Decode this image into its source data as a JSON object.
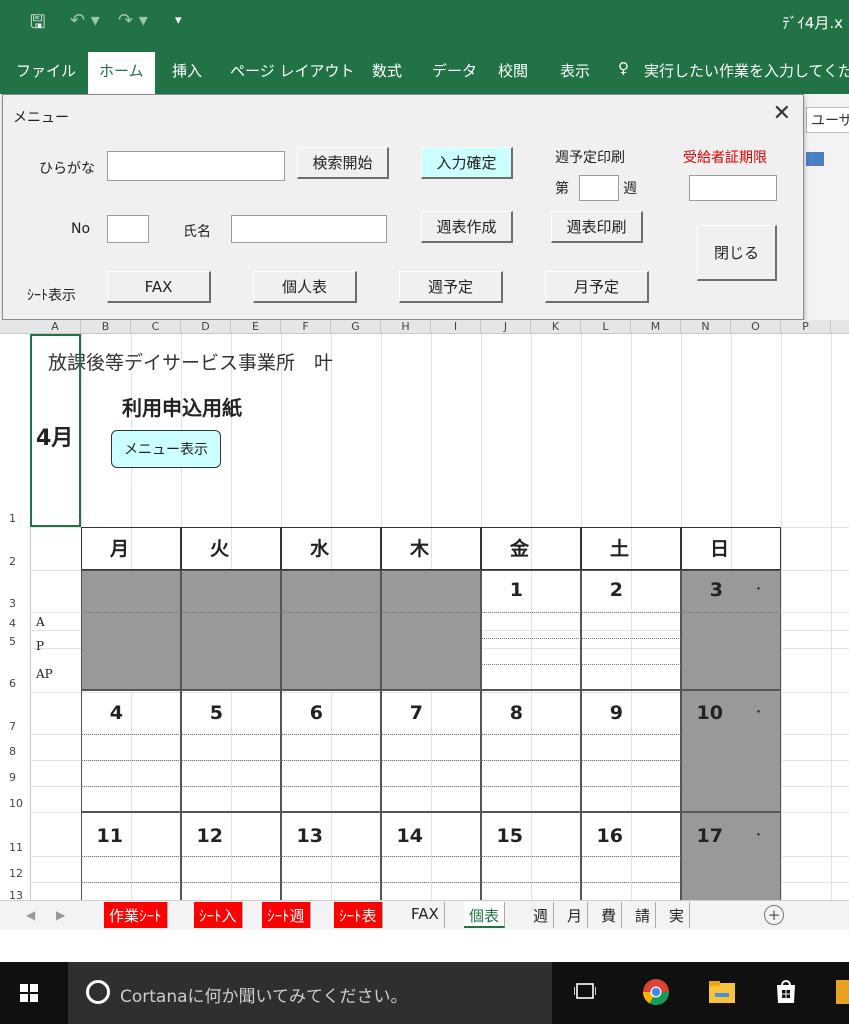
{
  "titlebar": {
    "save_icon": "🖫",
    "undo_icon": "↶ ▾",
    "redo_icon": "↷ ▾",
    "qat_more": "▾",
    "title": "ﾃﾞｲ4月.x"
  },
  "ribbon": {
    "tabs": [
      "ファイル",
      "ホーム",
      "挿入",
      "ページ レイアウト",
      "数式",
      "データ",
      "校閲",
      "表示"
    ],
    "active_tab": "ホーム",
    "tell_me_icon": "♀",
    "tell_me": "実行したい作業を入力してくだ",
    "user_box": "ユーザ"
  },
  "dialog": {
    "title": "メニュー",
    "close": "✕",
    "hiragana_label": "ひらがな",
    "search_button": "検索開始",
    "confirm_button": "入力確定",
    "weekly_print_label": "週予定印刷",
    "week_prefix": "第",
    "week_suffix": "週",
    "cert_label": "受給者証期限",
    "no_label": "No",
    "name_label": "氏名",
    "create_weekly_button": "週表作成",
    "print_weekly_button": "週表印刷",
    "close_button": "閉じる",
    "sheet_display_label": "ｼｰﾄ表示",
    "fax_button": "FAX",
    "personal_button": "個人表",
    "weekly_plan_button": "週予定",
    "monthly_plan_button": "月予定"
  },
  "columns": [
    "A",
    "B",
    "C",
    "D",
    "E",
    "F",
    "G",
    "H",
    "I",
    "J",
    "K",
    "L",
    "M",
    "N",
    "O",
    "P"
  ],
  "rows": [
    "1",
    "2",
    "3",
    "4",
    "5",
    "6",
    "7",
    "8",
    "9",
    "10",
    "11",
    "12",
    "13"
  ],
  "sheet": {
    "office": "放課後等デイサービス事業所　叶",
    "form_title": "利用申込用紙",
    "month": "4月",
    "menu_button": "メニュー表示",
    "days": [
      "月",
      "火",
      "水",
      "木",
      "金",
      "土",
      "日"
    ],
    "week1": [
      "",
      "",
      "",
      "",
      "1",
      "2",
      "3"
    ],
    "week2": [
      "4",
      "5",
      "6",
      "7",
      "8",
      "9",
      "10"
    ],
    "week3": [
      "11",
      "12",
      "13",
      "14",
      "15",
      "16",
      "17"
    ],
    "sunday_mark": "･",
    "ap_labels": [
      "A",
      "P",
      "AP"
    ]
  },
  "sheet_tabs": [
    {
      "label": "作業ｼｰﾄ",
      "style": "red"
    },
    {
      "label": "ｼｰﾄ入",
      "style": "red"
    },
    {
      "label": "ｼｰﾄ週",
      "style": "red"
    },
    {
      "label": "ｼｰﾄ表",
      "style": "red"
    },
    {
      "label": "FAX",
      "style": "normal"
    },
    {
      "label": "個表",
      "style": "active"
    },
    {
      "label": "週",
      "style": "normal"
    },
    {
      "label": "月",
      "style": "normal"
    },
    {
      "label": "費",
      "style": "normal"
    },
    {
      "label": "請",
      "style": "normal"
    },
    {
      "label": "実",
      "style": "normal"
    }
  ],
  "add_sheet": "+",
  "taskbar": {
    "search_placeholder": "Cortanaに何か聞いてみてください。"
  },
  "colors": {
    "excel_green": "#217346",
    "cyan_button": "#ccffff",
    "red_tab": "#ff0000",
    "gray_cell": "#999999"
  }
}
